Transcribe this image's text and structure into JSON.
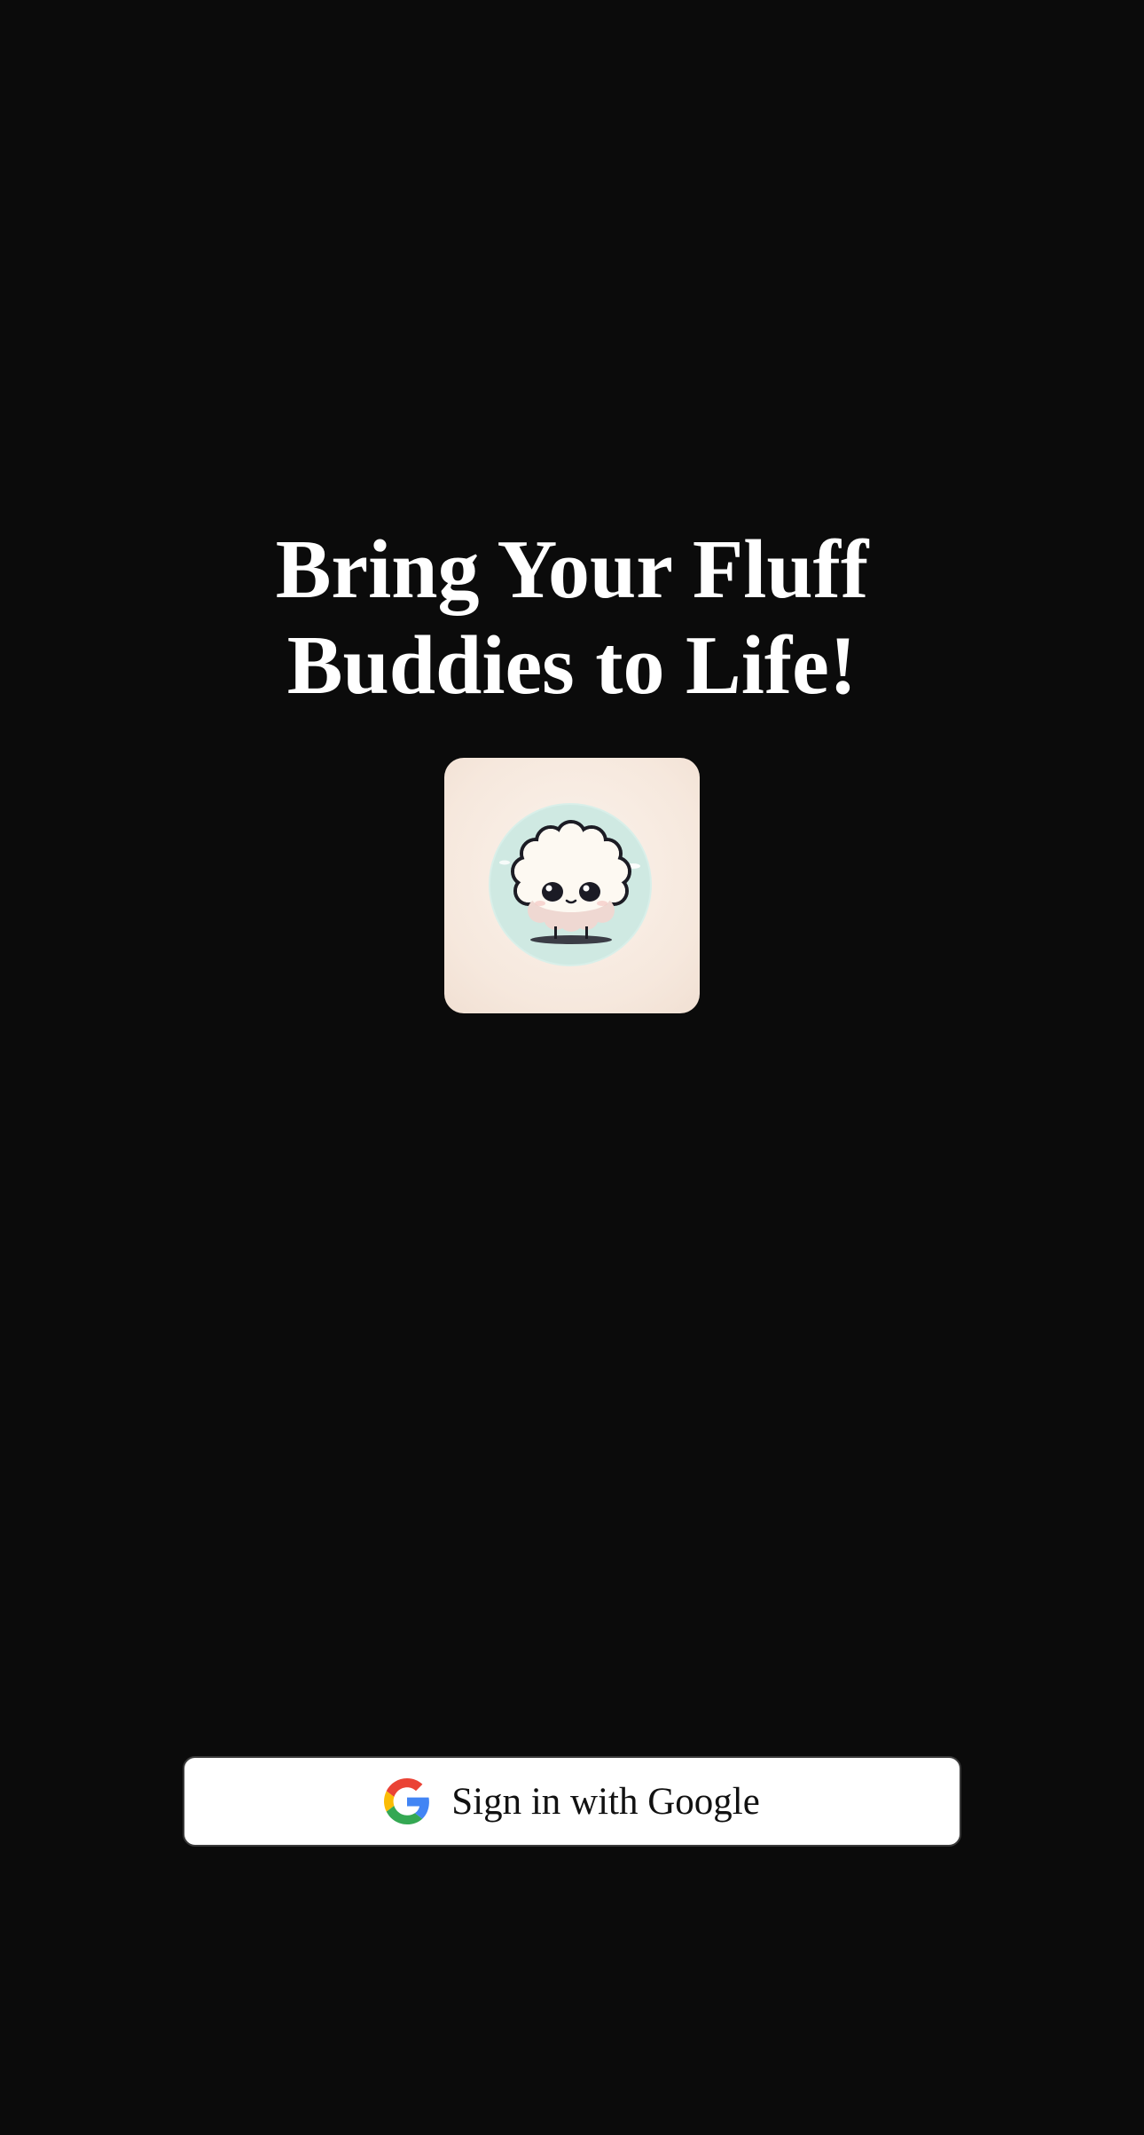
{
  "headline": {
    "line1": "Bring Your Fluff",
    "line2": "Buddies to Life!"
  },
  "logo": {
    "icon": "fluff-buddy-mascot-logo"
  },
  "auth": {
    "google_button_label": "Sign in with Google",
    "google_icon": "google-g-icon"
  },
  "colors": {
    "background": "#0b0b0b",
    "headline_text": "#ffffff",
    "button_background": "#ffffff",
    "button_text": "#111111"
  }
}
